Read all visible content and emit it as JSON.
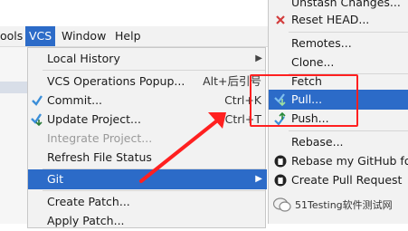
{
  "menubar": {
    "tools_label": "ools",
    "vcs_label": "VCS",
    "window_label": "Window",
    "help_label": "Help"
  },
  "vcs_menu": {
    "items": [
      {
        "label": "Local History",
        "shortcut": ""
      },
      {
        "label": "VCS Operations Popup...",
        "shortcut": "Alt+后引号"
      },
      {
        "label": "Commit...",
        "shortcut": "Ctrl+K"
      },
      {
        "label": "Update Project...",
        "shortcut": "Ctrl+T"
      },
      {
        "label": "Integrate Project...",
        "shortcut": ""
      },
      {
        "label": "Refresh File Status",
        "shortcut": ""
      },
      {
        "label": "Git",
        "shortcut": ""
      },
      {
        "label": "Create Patch...",
        "shortcut": ""
      },
      {
        "label": "Apply Patch...",
        "shortcut": ""
      }
    ]
  },
  "git_menu": {
    "items": [
      {
        "label": "Unstash Changes..."
      },
      {
        "label": "Reset HEAD..."
      },
      {
        "label": "Remotes..."
      },
      {
        "label": "Clone..."
      },
      {
        "label": "Fetch"
      },
      {
        "label": "Pull..."
      },
      {
        "label": "Push..."
      },
      {
        "label": "Rebase..."
      },
      {
        "label": "Rebase my GitHub for"
      },
      {
        "label": "Create Pull Request"
      }
    ]
  },
  "watermark": {
    "text": "51Testing软件测试网"
  },
  "colors": {
    "selection": "#2c6bc8",
    "annotation": "#ff2020",
    "menu_bg": "#f2f2f2"
  }
}
